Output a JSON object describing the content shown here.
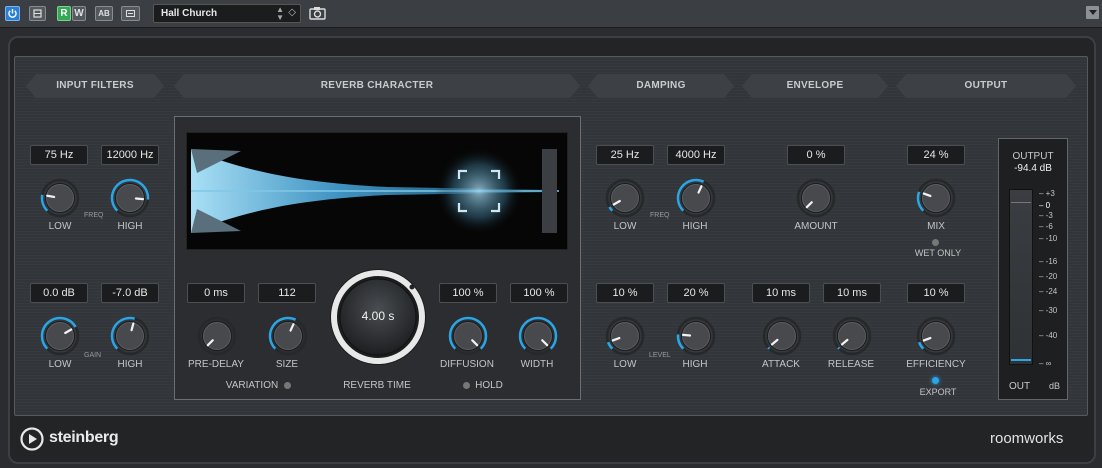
{
  "toolbar": {
    "preset_name": "Hall Church",
    "buttons": [
      "power-icon",
      "bypass-icon",
      "read-icon",
      "write-icon",
      "ab-compare-icon",
      "settings-icon"
    ],
    "read_label": "R",
    "write_label": "W",
    "ab_label": "AB"
  },
  "sections": {
    "input_filters": "INPUT FILTERS",
    "reverb_character": "REVERB CHARACTER",
    "damping": "DAMPING",
    "envelope": "ENVELOPE",
    "output": "OUTPUT"
  },
  "input_filters": {
    "freq_low_value": "75 Hz",
    "freq_high_value": "12000 Hz",
    "freq_label": "FREQ",
    "gain_low_value": "0.0 dB",
    "gain_high_value": "-7.0 dB",
    "gain_label": "GAIN",
    "low_label": "LOW",
    "high_label": "HIGH"
  },
  "reverb_character": {
    "pre_delay_value": "0 ms",
    "pre_delay_label": "PRE-DELAY",
    "size_value": "112",
    "size_label": "SIZE",
    "reverb_time_value": "4.00 s",
    "reverb_time_label": "REVERB TIME",
    "diffusion_value": "100 %",
    "diffusion_label": "DIFFUSION",
    "width_value": "100 %",
    "width_label": "WIDTH",
    "variation_label": "VARIATION",
    "hold_label": "HOLD"
  },
  "damping": {
    "freq_low_value": "25 Hz",
    "freq_high_value": "4000 Hz",
    "freq_label": "FREQ",
    "level_low_value": "10 %",
    "level_high_value": "20 %",
    "level_label": "LEVEL",
    "low_label": "LOW",
    "high_label": "HIGH"
  },
  "envelope": {
    "amount_value": "0 %",
    "amount_label": "AMOUNT",
    "attack_value": "10 ms",
    "attack_label": "ATTACK",
    "release_value": "10 ms",
    "release_label": "RELEASE"
  },
  "output": {
    "mix_value": "24 %",
    "mix_label": "MIX",
    "wet_only_label": "WET ONLY",
    "efficiency_value": "10 %",
    "efficiency_label": "EFFICIENCY",
    "export_label": "EXPORT",
    "meter_title": "OUTPUT",
    "meter_value": "-94.4 dB",
    "meter_out_label": "OUT",
    "meter_db_label": "dB",
    "meter_scale": [
      "+3",
      "0",
      "-3",
      "-6",
      "-10",
      "-16",
      "-20",
      "-24",
      "-30",
      "-40",
      "∞"
    ]
  },
  "footer": {
    "brand": "steinberg",
    "product": "roomworks"
  },
  "colors": {
    "accent": "#2aa6e6",
    "panel": "#323539",
    "display_fill": "#7fc8e8"
  }
}
